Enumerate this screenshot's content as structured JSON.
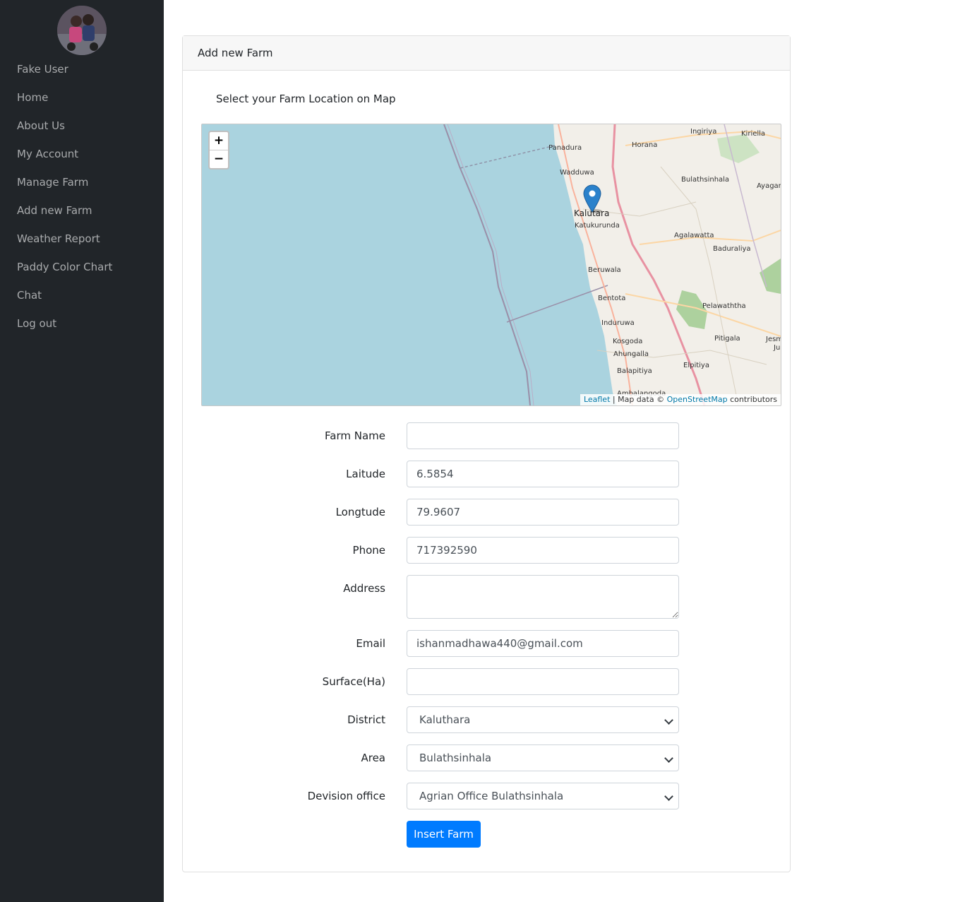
{
  "user": {
    "name": "Fake User"
  },
  "sidebar": {
    "items": [
      {
        "label": "Home"
      },
      {
        "label": "About Us"
      },
      {
        "label": "My Account"
      },
      {
        "label": "Manage Farm"
      },
      {
        "label": "Add new Farm"
      },
      {
        "label": "Weather Report"
      },
      {
        "label": "Paddy Color Chart"
      },
      {
        "label": "Chat"
      },
      {
        "label": "Log out"
      }
    ]
  },
  "card": {
    "title": "Add new Farm"
  },
  "map": {
    "caption": "Select your Farm Location on Map",
    "zoom_in": "+",
    "zoom_out": "−",
    "attribution_leaflet": "Leaflet",
    "attribution_middle": " | Map data © ",
    "attribution_osm": "OpenStreetMap",
    "attribution_end": " contributors",
    "towns": {
      "panadura": "Panadura",
      "horana": "Horana",
      "ingiriya": "Ingiriya",
      "kiriella": "Kiriella",
      "wadduwa": "Wadduwa",
      "bulathsinhala": "Bulathsinhala",
      "ayagama": "Ayagan",
      "kalutara": "Kalutara",
      "katukurunda": "Katukurunda",
      "agalawatta": "Agalawatta",
      "baduraliya": "Baduraliya",
      "beruwala": "Beruwala",
      "bentota": "Bentota",
      "pelawaththa": "Pelawaththa",
      "induruwa": "Induruwa",
      "kosgoda": "Kosgoda",
      "pitigala": "Pitigala",
      "jesm": "Jesm",
      "ju": "Ju",
      "ahungalla": "Ahungalla",
      "elpitiya": "Elpitiya",
      "balapitiya": "Balapitiya",
      "ambalangoda": "Ambalangoda"
    }
  },
  "form": {
    "farm_name": {
      "label": "Farm Name",
      "value": ""
    },
    "latitude": {
      "label": "Laitude",
      "value": "6.5854"
    },
    "longitude": {
      "label": "Longtude",
      "value": "79.9607"
    },
    "phone": {
      "label": "Phone",
      "value": "717392590"
    },
    "address": {
      "label": "Address",
      "value": ""
    },
    "email": {
      "label": "Email",
      "value": "ishanmadhawa440@gmail.com"
    },
    "surface": {
      "label": "Surface(Ha)",
      "value": ""
    },
    "district": {
      "label": "District",
      "value": "Kaluthara"
    },
    "area": {
      "label": "Area",
      "value": "Bulathsinhala"
    },
    "division": {
      "label": "Devision office",
      "value": "Agrian Office Bulathsinhala"
    },
    "submit_label": "Insert Farm"
  },
  "colors": {
    "sidebar_bg": "#212529",
    "primary": "#007bff",
    "water": "#aad3df",
    "land": "#f2efe9"
  }
}
